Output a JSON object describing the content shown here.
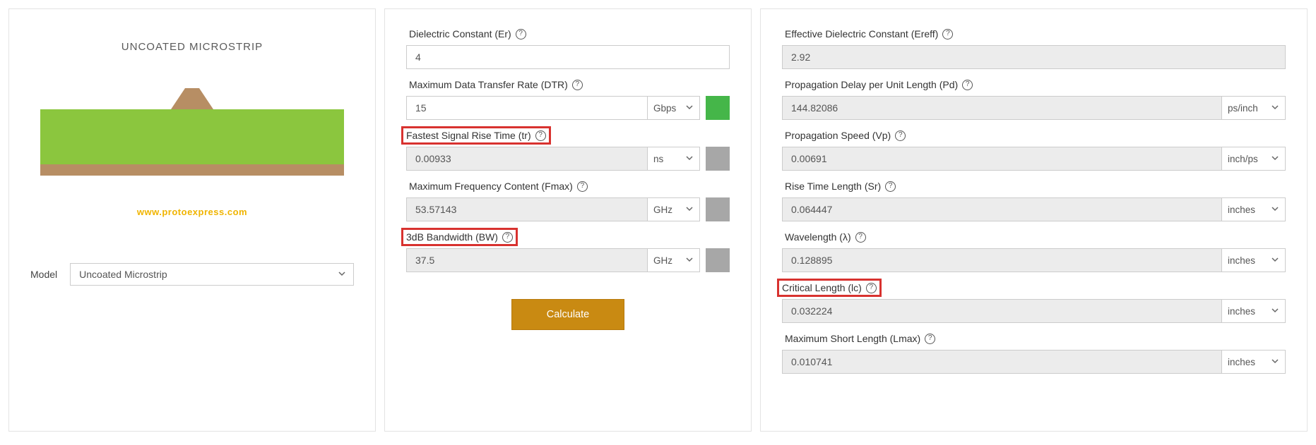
{
  "left": {
    "title": "UNCOATED MICROSTRIP",
    "watermark": "www.protoexpress.com",
    "model_label": "Model",
    "model_value": "Uncoated Microstrip"
  },
  "middle": {
    "er_label": "Dielectric Constant (Er)",
    "er_value": "4",
    "dtr_label": "Maximum Data Transfer Rate (DTR)",
    "dtr_value": "15",
    "dtr_unit": "Gbps",
    "tr_label": "Fastest Signal Rise Time (tr)",
    "tr_value": "0.00933",
    "tr_unit": "ns",
    "fmax_label": "Maximum Frequency Content (Fmax)",
    "fmax_value": "53.57143",
    "fmax_unit": "GHz",
    "bw_label": "3dB Bandwidth (BW)",
    "bw_value": "37.5",
    "bw_unit": "GHz",
    "calculate": "Calculate"
  },
  "right": {
    "ereff_label": "Effective Dielectric Constant (Ereff)",
    "ereff_value": "2.92",
    "pd_label": "Propagation Delay per Unit Length (Pd)",
    "pd_value": "144.82086",
    "pd_unit": "ps/inch",
    "vp_label": "Propagation Speed (Vp)",
    "vp_value": "0.00691",
    "vp_unit": "inch/ps",
    "sr_label": "Rise Time Length (Sr)",
    "sr_value": "0.064447",
    "sr_unit": "inches",
    "lambda_label": "Wavelength (λ)",
    "lambda_value": "0.128895",
    "lambda_unit": "inches",
    "lc_label": "Critical Length (lc)",
    "lc_value": "0.032224",
    "lc_unit": "inches",
    "lmax_label": "Maximum Short Length (Lmax)",
    "lmax_value": "0.010741",
    "lmax_unit": "inches"
  }
}
